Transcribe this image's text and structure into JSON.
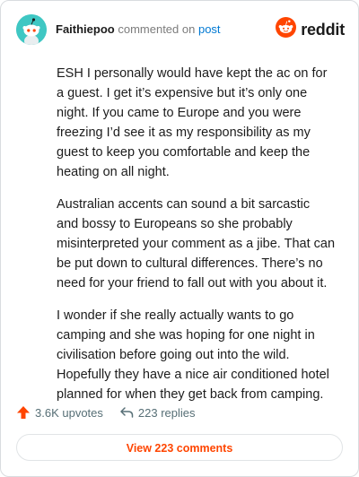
{
  "comment": {
    "username": "Faithiepoo",
    "action_text": "commented on",
    "post_link_label": "post",
    "avatar_icon": "snoo-avatar-icon",
    "paragraphs": [
      "ESH I personally would have kept the ac on for a guest. I get it’s expensive but it’s only one night. If you came to Europe and you were freezing I’d see it as my responsibility as my guest to keep you comfortable and keep the heating on all night.",
      "Australian accents can sound a bit sarcastic and bossy to Europeans so she probably misinterpreted your comment as a jibe. That can be put down to cultural differences. There’s no need for your friend to fall out with you about it.",
      "I wonder if she really actually wants to go camping and she was hoping for one night in civilisation before going out into the wild. Hopefully they have a nice air conditioned hotel planned for when they get back from camping."
    ]
  },
  "brand": {
    "wordmark": "reddit",
    "logo_icon": "reddit-logo-icon",
    "color": "#ff4500"
  },
  "actions": {
    "upvotes": "3.6K upvotes",
    "upvote_icon": "upvote-arrow-icon",
    "replies": "223 replies",
    "reply_icon": "reply-arrow-icon"
  },
  "footer": {
    "view_comments_label": "View 223 comments"
  }
}
